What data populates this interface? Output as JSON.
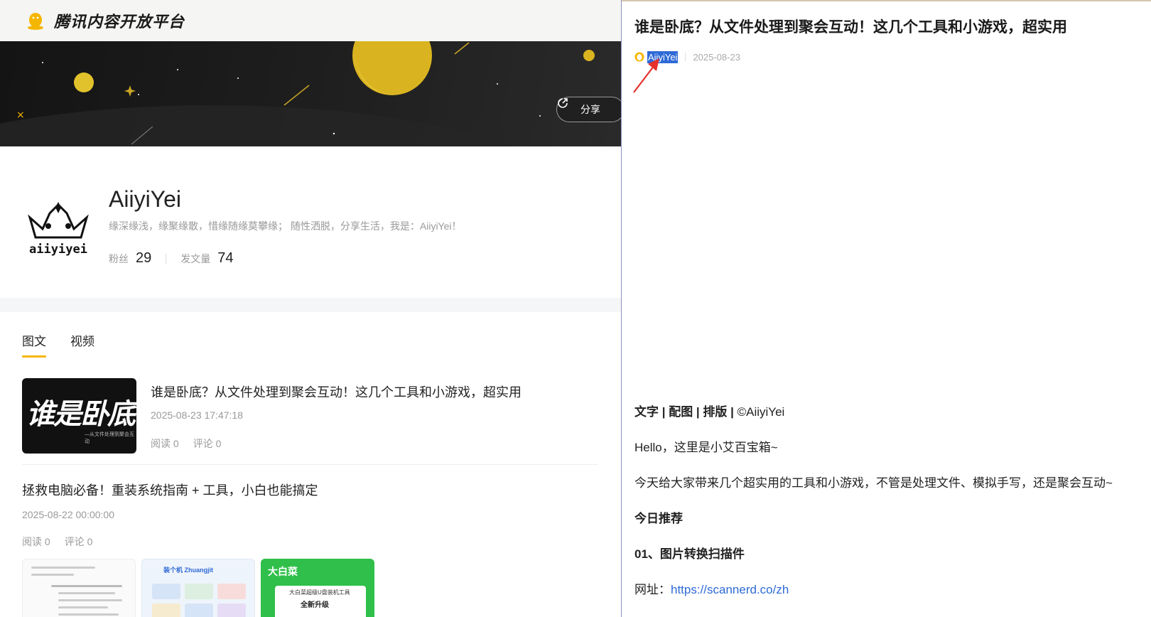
{
  "brand": {
    "name": "腾讯内容开放平台",
    "color": "#f5b600"
  },
  "banner": {
    "share_label": "分享"
  },
  "profile": {
    "name": "AiiyiYei",
    "bio": "缘深缘浅，缘聚缘散，惜缘随缘莫攀缘； 随性洒脱，分享生活，我是：AiiyiYei！",
    "avatar_text": "aiiyiyei",
    "fans_label": "粉丝",
    "fans_count": "29",
    "posts_label": "发文量",
    "posts_count": "74"
  },
  "tabs": [
    {
      "label": "图文",
      "active": true
    },
    {
      "label": "视频",
      "active": false
    }
  ],
  "articles": [
    {
      "title": "谁是卧底？从文件处理到聚会互动！这几个工具和小游戏，超实用",
      "time": "2025-08-23 17:47:18",
      "reads": "阅读 0",
      "comments": "评论 0",
      "thumb_text": "谁是卧底?",
      "thumb_sub": "—从文件处理到聚会互动"
    },
    {
      "title": "拯救电脑必备！重装系统指南 + 工具，小白也能搞定",
      "time": "2025-08-22 00:00:00",
      "reads": "阅读 0",
      "comments": "评论 0",
      "thumb3_brand": "大白菜",
      "thumb3_line1": "大白菜超级U盘装机工具",
      "thumb3_line2": "全新升级",
      "thumb2_title": "装个机 Zhuangjit"
    }
  ],
  "detail": {
    "title": "谁是卧底？从文件处理到聚会互动！这几个工具和小游戏，超实用",
    "author": "AiiyiYei",
    "date": "2025-08-23",
    "credits": "文字 | 配图 | 排版 | ©AiiyiYei",
    "credits_bold": "文字 | 配图 | 排版 |",
    "credits_tail": " ©AiiyiYei",
    "p1": "Hello，这里是小艾百宝箱~",
    "p2": "今天给大家带来几个超实用的工具和小游戏，不管是处理文件、模拟手写，还是聚会互动~",
    "h1": "今日推荐",
    "h2": "01、图片转换扫描件",
    "url_label": "网址：",
    "url": "https://scannerd.co/zh"
  }
}
